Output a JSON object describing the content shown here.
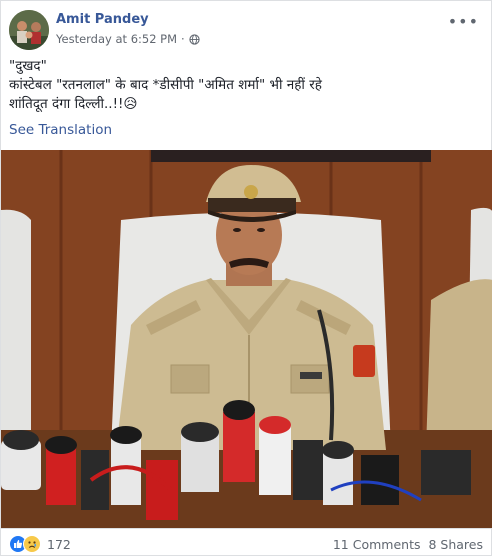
{
  "post": {
    "author": "Amit Pandey",
    "timestamp": "Yesterday at 6:52 PM",
    "separator": "·",
    "audience_icon": "globe-icon",
    "more_icon": "more-options-icon",
    "lines": [
      "\"दुखद\"",
      "कांस्टेबल \"रतनलाल\" के बाद *डीसीपी \"अमित शर्मा\" भी नहीं रहे",
      "शांतिदूत दंगा दिल्ली..!!😥"
    ],
    "see_translation": "See Translation",
    "photo_icon": "police-press-conference-photo"
  },
  "footer": {
    "reaction_icons": [
      "like-icon",
      "sad-icon"
    ],
    "reaction_count": "172",
    "comments": "11 Comments",
    "shares": "8 Shares"
  },
  "colors": {
    "link": "#385898",
    "like_blue": "#2078f4",
    "meta_gray": "#616770"
  }
}
